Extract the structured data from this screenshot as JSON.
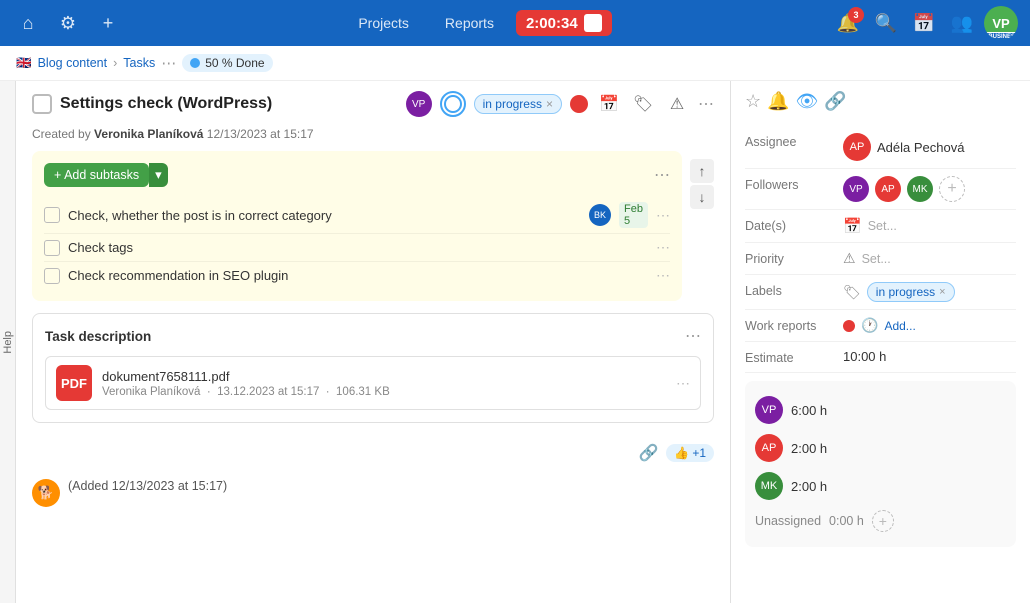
{
  "topnav": {
    "home_icon": "⌂",
    "settings_icon": "⚙",
    "add_icon": "+",
    "projects_label": "Projects",
    "reports_label": "Reports",
    "timer": "2:00:34",
    "notif_count": "3",
    "search_icon": "🔍",
    "calendar_icon": "📅",
    "people_icon": "👥",
    "avatar_initials": "VP",
    "business_label": "BUSINESS"
  },
  "breadcrumb": {
    "flag": "🇬🇧",
    "blog_content": "Blog content",
    "tasks_label": "Tasks",
    "progress": "50 % Done"
  },
  "task": {
    "title": "Settings check (WordPress)",
    "status": "in progress",
    "created_by": "Veronika Planíková",
    "created_at": "12/13/2023 at 15:17"
  },
  "subtasks": {
    "add_label": "+ Add subtasks",
    "items": [
      {
        "text": "Check, whether the post is in correct category",
        "assignee": "BK",
        "date_label": "Feb",
        "date_num": "5"
      },
      {
        "text": "Check tags",
        "assignee": "",
        "date_label": "",
        "date_num": ""
      },
      {
        "text": "Check recommendation in SEO plugin",
        "assignee": "",
        "date_label": "",
        "date_num": ""
      }
    ]
  },
  "description": {
    "title": "Task description",
    "attachment": {
      "name": "dokument7658111.pdf",
      "author": "Veronika Planíková",
      "date": "13.12.2023 at 15:17",
      "size": "106.31 KB"
    }
  },
  "comment": {
    "added_label": "(Added 12/13/2023 at 15:17)"
  },
  "right_panel": {
    "assignee_label": "Assignee",
    "assignee_name": "Adéla Pechová",
    "followers_label": "Followers",
    "dates_label": "Date(s)",
    "dates_placeholder": "Set...",
    "priority_label": "Priority",
    "priority_placeholder": "Set...",
    "labels_label": "Labels",
    "label_value": "in progress",
    "work_reports_label": "Work reports",
    "work_reports_add": "Add...",
    "estimate_label": "Estimate",
    "estimate_value": "10:00 h",
    "time_entries": [
      {
        "hours": "6:00 h",
        "color": "#7b1fa2"
      },
      {
        "hours": "2:00 h",
        "color": "#e53935"
      },
      {
        "hours": "2:00 h",
        "color": "#388e3c"
      }
    ],
    "unassigned_label": "Unassigned",
    "unassigned_hours": "0:00 h"
  }
}
